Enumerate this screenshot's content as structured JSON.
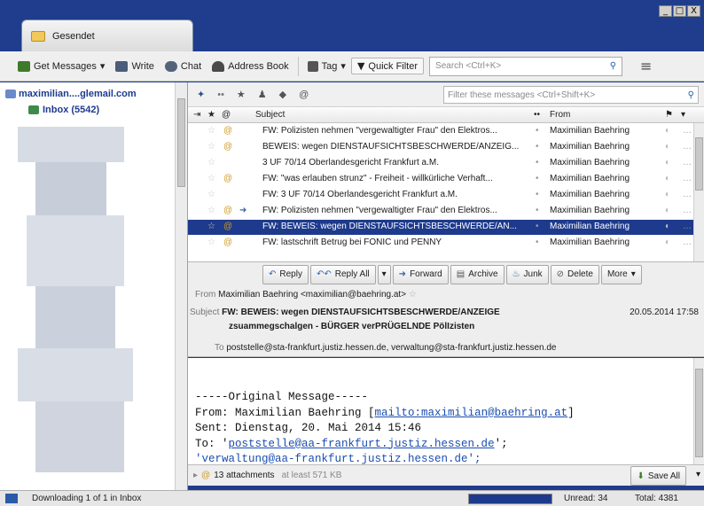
{
  "window": {
    "controls": [
      "_",
      "□",
      "X"
    ]
  },
  "tab": {
    "label": "Gesendet"
  },
  "toolbar": {
    "get_messages": "Get Messages",
    "write": "Write",
    "chat": "Chat",
    "address_book": "Address Book",
    "tag": "Tag",
    "quick_filter": "Quick Filter",
    "search_placeholder": "Search <Ctrl+K>"
  },
  "folders": {
    "account": "maximilian....gl​email.com",
    "inbox": "Inbox (5542)"
  },
  "filter": {
    "placeholder": "Filter these messages <Ctrl+Shift+K>"
  },
  "columns": {
    "subject": "Subject",
    "from": "From"
  },
  "messages": [
    {
      "subject": "FW: Polizisten nehmen \"vergewaltigter Frau\" den Elektros...",
      "from": "Maximilian Baehring",
      "attachment": true,
      "forwarded": false
    },
    {
      "subject": "BEWEIS: wegen DIENSTAUFSICHTSBESCHWERDE/ANZEIG...",
      "from": "Maximilian Baehring",
      "attachment": true,
      "forwarded": false
    },
    {
      "subject": "3 UF 70/14 Oberlandesgericht Frankfurt a.M.",
      "from": "Maximilian Baehring",
      "attachment": false,
      "forwarded": false
    },
    {
      "subject": "FW: \"was erlauben strunz\" - Freiheit - willkürliche Verhaft...",
      "from": "Maximilian Baehring",
      "attachment": true,
      "forwarded": false
    },
    {
      "subject": "FW: 3 UF 70/14 Oberlandesgericht Frankfurt a.M.",
      "from": "Maximilian Baehring",
      "attachment": false,
      "forwarded": false
    },
    {
      "subject": "FW: Polizisten nehmen \"vergewaltigter Frau\" den Elektros...",
      "from": "Maximilian Baehring",
      "attachment": true,
      "forwarded": true
    },
    {
      "subject": "FW: BEWEIS: wegen DIENSTAUFSICHTSBESCHWERDE/AN...",
      "from": "Maximilian Baehring",
      "attachment": true,
      "forwarded": false,
      "selected": true
    },
    {
      "subject": "FW: lastschrift Betrug bei FONIC und PENNY",
      "from": "Maximilian Baehring",
      "attachment": true,
      "forwarded": false
    }
  ],
  "actions": {
    "reply": "Reply",
    "reply_all": "Reply All",
    "forward": "Forward",
    "archive": "Archive",
    "junk": "Junk",
    "delete": "Delete",
    "more": "More"
  },
  "header": {
    "from_label": "From",
    "from_value": "Maximilian Baehring <maximilian@baehring.at>",
    "subject_label": "Subject",
    "subject_line1": "FW: BEWEIS: wegen DIENSTAUFSICHTSBESCHWERDE/ANZEIGE",
    "subject_line2": "zsuammegschalgen - BÜRGER verPRÜGELNDE PölIzisten",
    "date": "20.05.2014 17:58",
    "to_label": "To",
    "to_value": "poststelle@sta-frankfurt.justiz.hessen.de, verwaltung@sta-frankfurt.justiz.hessen.de"
  },
  "body": {
    "line1": "-----Original Message-----",
    "from_prefix": "From: Maximilian Baehring [",
    "from_link": "mailto:maximilian@baehring.at",
    "from_suffix": "]",
    "sent": "Sent: Dienstag, 20. Mai 2014 15:46",
    "to_prefix": "To: '",
    "to_link": "poststelle@aa-frankfurt.justiz.hessen.de",
    "to_suffix": "';",
    "line5": "'verwaltung@aa-frankfurt.justiz.hessen.de';"
  },
  "attachments": {
    "count": "13 attachments",
    "size": "at least 571 KB",
    "save_all": "Save All"
  },
  "status": {
    "text": "Downloading 1 of 1 in Inbox",
    "unread": "Unread: 34",
    "total": "Total: 4381"
  }
}
